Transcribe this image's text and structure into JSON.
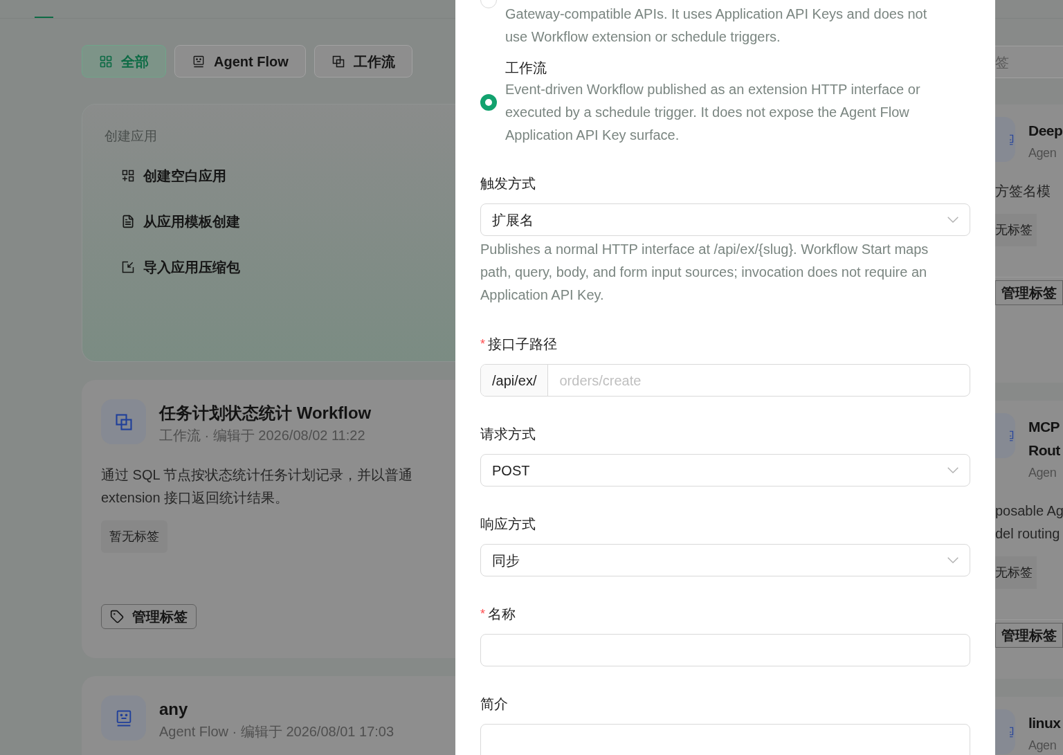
{
  "filter_tabs": [
    {
      "kind": "all",
      "label": "全部",
      "selected": true
    },
    {
      "kind": "agent_flow",
      "label": "Agent Flow",
      "selected": false
    },
    {
      "kind": "workflow",
      "label": "工作流",
      "selected": false
    }
  ],
  "create_card": {
    "title": "创建应用",
    "items": [
      {
        "kind": "blank",
        "label": "创建空白应用"
      },
      {
        "kind": "template",
        "label": "从应用模板创建"
      },
      {
        "kind": "import",
        "label": "导入应用压缩包"
      }
    ]
  },
  "app_cards": [
    {
      "kind": "workflow",
      "title": "任务计划状态统计 Workflow",
      "meta": "工作流 · 编辑于 2026/08/02 11:22",
      "description": "通过 SQL 节点按状态统计任务计划记录，并以普通 extension 接口返回统计结果。",
      "tag": "暂无标签",
      "manage_button": "管理标签"
    },
    {
      "kind": "agent_flow",
      "title": "any",
      "meta": "Agent Flow · 编辑于 2026/08/01 17:03"
    }
  ],
  "right_column": {
    "search_placeholder": "签",
    "cards": [
      {
        "title_lines": [
          "Deep"
        ],
        "meta": "Agen",
        "description_lines": [
          "方签名模"
        ],
        "tag": "无标签",
        "manage_button": "管理标签"
      },
      {
        "title_lines": [
          "MCP",
          "Rout"
        ],
        "meta": "Agen",
        "description_lines": [
          "posable Ag",
          "del routing"
        ],
        "tag": "无标签",
        "manage_button": "管理标签"
      },
      {
        "title_lines": [
          "linux"
        ],
        "meta": "Agen"
      }
    ]
  },
  "drawer": {
    "app_types": [
      {
        "description": "Gateway-compatible APIs. It uses Application API Keys and does not use Workflow extension or schedule triggers.",
        "selected": false
      },
      {
        "label": "工作流",
        "description": "Event-driven Workflow published as an extension HTTP interface or executed by a schedule trigger. It does not expose the Agent Flow Application API Key surface.",
        "selected": true
      }
    ],
    "fields": [
      {
        "kind": "select",
        "label": "触发方式",
        "value": "扩展名",
        "help": "Publishes a normal HTTP interface at /api/ex/{slug}. Workflow Start maps path, query, body, and form input sources; invocation does not require an Application API Key."
      },
      {
        "kind": "prefixed_input",
        "label": "接口子路径",
        "required_mark": "*",
        "prefix": "/api/ex/",
        "placeholder": "orders/create"
      },
      {
        "kind": "select",
        "label": "请求方式",
        "value": "POST"
      },
      {
        "kind": "select",
        "label": "响应方式",
        "value": "同步"
      },
      {
        "kind": "input",
        "label": "名称",
        "required_mark": "*"
      },
      {
        "kind": "textarea",
        "label": "简介"
      }
    ]
  }
}
